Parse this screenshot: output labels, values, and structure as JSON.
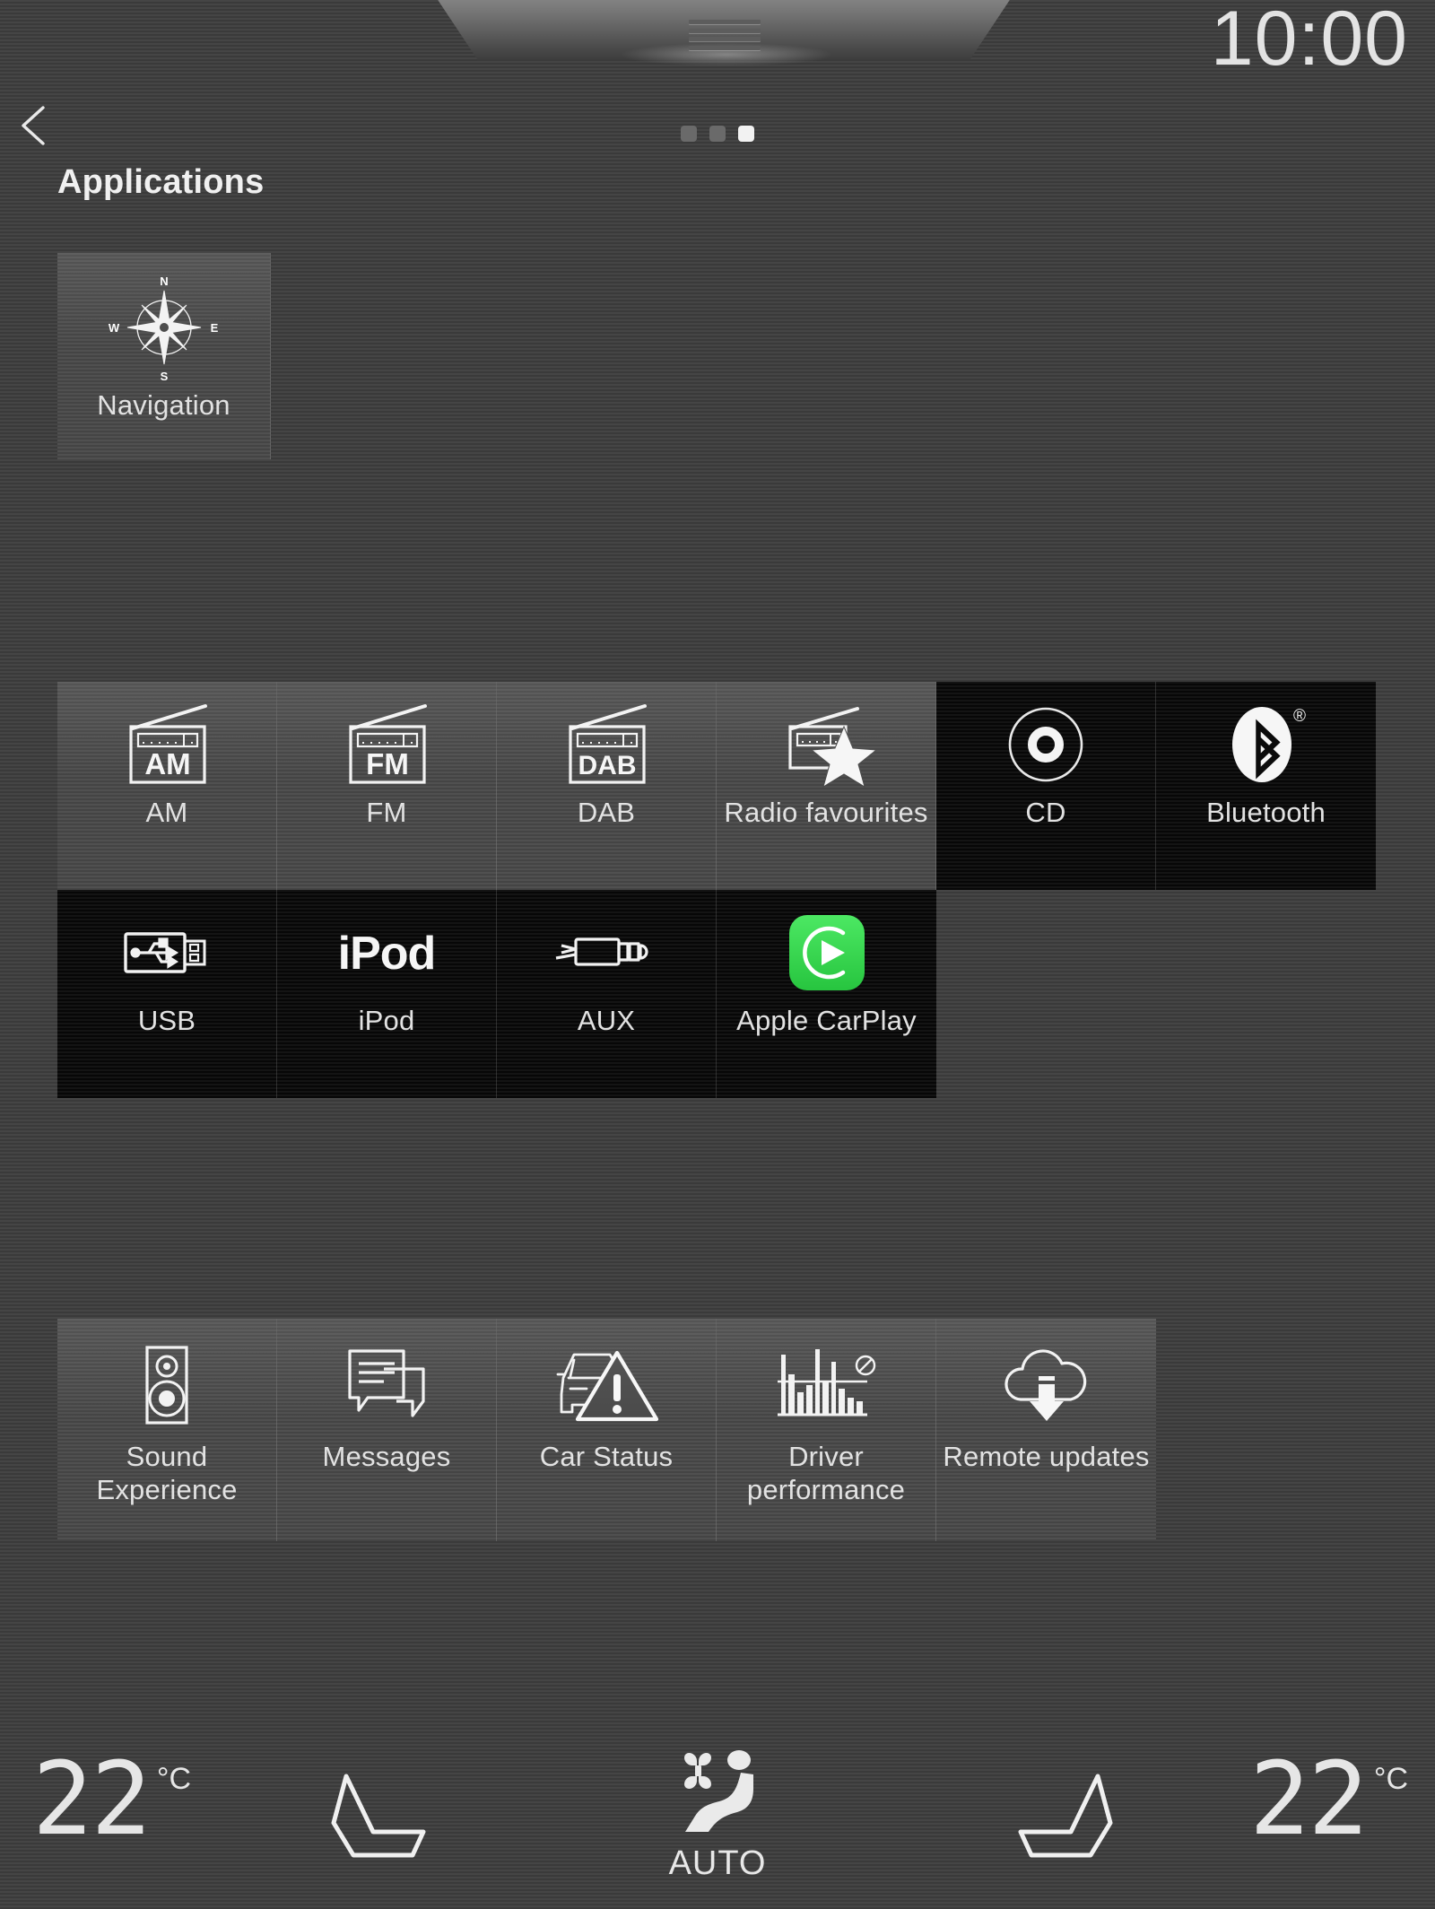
{
  "statusbar": {
    "clock": "10:00"
  },
  "header": {
    "back_icon": "chevron-left-icon",
    "title": "Applications",
    "pages": {
      "total": 3,
      "active_index": 2
    }
  },
  "colors": {
    "background": "#3f3f3f",
    "tile_active": "#4a4a4a",
    "tile_dark": "#0b0b0b",
    "text": "#e2e2e2",
    "carplay_green": "#32d74b",
    "accent_white": "#f2f2f2"
  },
  "groups": [
    {
      "name": "navigation",
      "tiles": [
        {
          "label": "Navigation",
          "icon": "compass-rose-icon",
          "state": "grey"
        }
      ]
    },
    {
      "name": "media-sources",
      "tiles": [
        {
          "label": "AM",
          "icon": "radio-am-icon",
          "state": "grey"
        },
        {
          "label": "FM",
          "icon": "radio-fm-icon",
          "state": "grey"
        },
        {
          "label": "DAB",
          "icon": "radio-dab-icon",
          "state": "grey"
        },
        {
          "label": "Radio favourites",
          "icon": "radio-favourites-icon",
          "state": "grey"
        },
        {
          "label": "CD",
          "icon": "cd-disc-icon",
          "state": "dark"
        },
        {
          "label": "Bluetooth",
          "icon": "bluetooth-icon",
          "state": "dark"
        },
        {
          "label": "USB",
          "icon": "usb-connector-icon",
          "state": "dark"
        },
        {
          "label": "iPod",
          "icon": "ipod-wordmark-icon",
          "state": "dark"
        },
        {
          "label": "AUX",
          "icon": "aux-jack-icon",
          "state": "dark"
        },
        {
          "label": "Apple CarPlay",
          "icon": "apple-carplay-icon",
          "state": "dark"
        }
      ]
    },
    {
      "name": "vehicle-apps",
      "tiles": [
        {
          "label": "Sound Experience",
          "icon": "speaker-icon",
          "state": "grey"
        },
        {
          "label": "Messages",
          "icon": "message-bubbles-icon",
          "state": "grey"
        },
        {
          "label": "Car Status",
          "icon": "car-warning-icon",
          "state": "grey"
        },
        {
          "label": "Driver performance",
          "icon": "bar-chart-icon",
          "state": "grey"
        },
        {
          "label": "Remote updates",
          "icon": "cloud-download-icon",
          "state": "grey"
        }
      ]
    }
  ],
  "icon_text": {
    "am": "AM",
    "fm": "FM",
    "dab": "DAB",
    "ipod": "iPod",
    "compass_n": "N",
    "compass_e": "E",
    "compass_s": "S",
    "compass_w": "W",
    "bluetooth_registered": "®"
  },
  "climate": {
    "left": {
      "temperature": "22",
      "unit": "°C",
      "seat_icon": "seat-left-icon"
    },
    "right": {
      "temperature": "22",
      "unit": "°C",
      "seat_icon": "seat-right-icon"
    },
    "center": {
      "icon": "auto-climate-fan-person-icon",
      "label": "AUTO"
    }
  }
}
